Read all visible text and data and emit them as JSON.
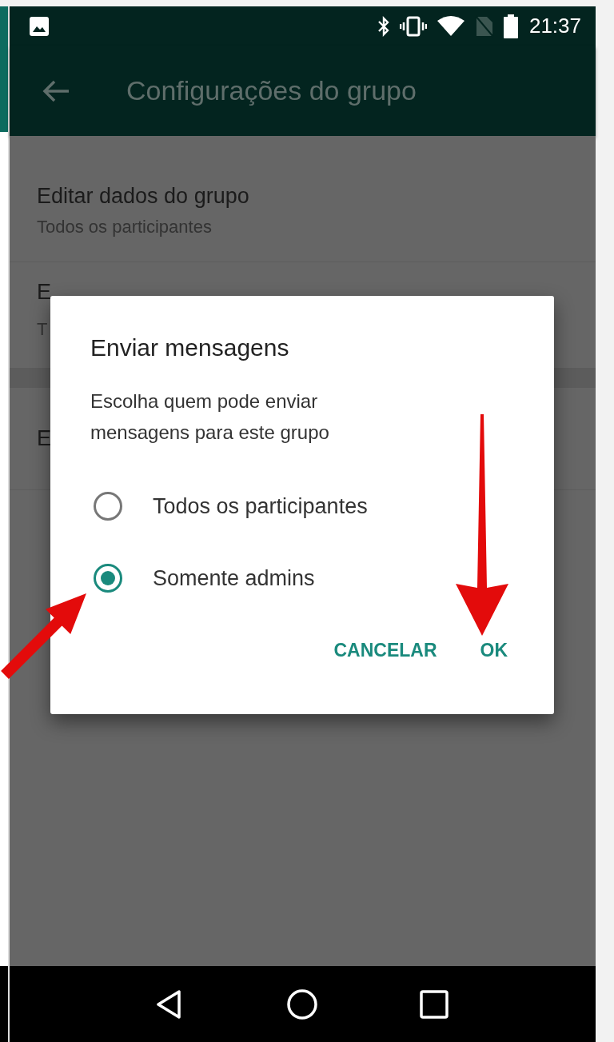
{
  "status_bar": {
    "time": "21:37"
  },
  "app_bar": {
    "title": "Configurações do grupo"
  },
  "settings": [
    {
      "title": "Editar dados do grupo",
      "subtitle": "Todos os participantes"
    },
    {
      "title": "E",
      "subtitle": "T"
    },
    {
      "title": "E"
    }
  ],
  "dialog": {
    "title": "Enviar mensagens",
    "message": "Escolha quem pode enviar mensagens para este grupo",
    "options": [
      {
        "label": "Todos os participantes",
        "selected": false
      },
      {
        "label": "Somente admins",
        "selected": true
      }
    ],
    "buttons": [
      "CANCELAR",
      "OK"
    ]
  }
}
